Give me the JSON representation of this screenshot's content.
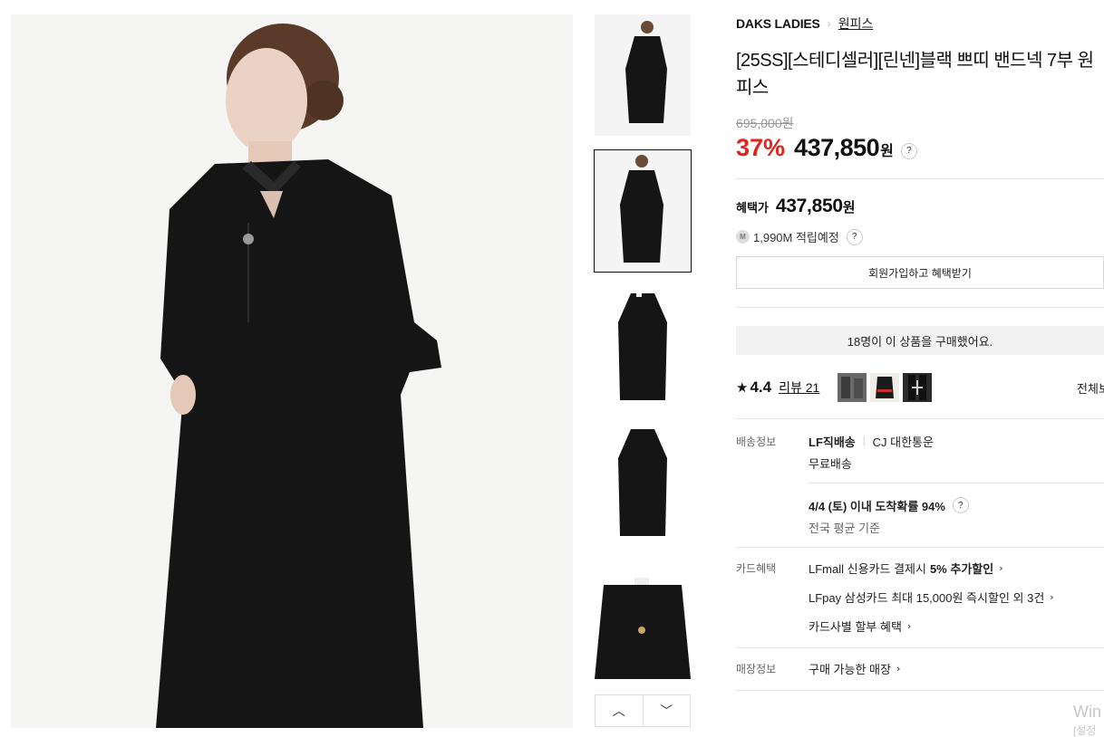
{
  "breadcrumb": {
    "brand": "DAKS LADIES",
    "category": "원피스"
  },
  "product": {
    "title": "[25SS][스테디셀러][린넨]블랙 쁘띠 밴드넥 7부 원피스",
    "original_price": "695,000원",
    "discount": "37%",
    "sale_price": "437,850",
    "currency": "원",
    "help": "?"
  },
  "benefit": {
    "label": "혜택가",
    "price": "437,850",
    "currency": "원",
    "points_icon": "M",
    "points": "1,990M 적립예정",
    "help": "?",
    "join_button": "회원가입하고 혜택받기"
  },
  "buyers_note": "18명이 이 상품을 구매했어요.",
  "review": {
    "star": "★",
    "rating": "4.4",
    "link": "리뷰 21",
    "view_all": "전체보기"
  },
  "shipping": {
    "label": "배송정보",
    "method": "LF직배송",
    "carrier": "CJ 대한통운",
    "fee": "무료배송",
    "arrival": "4/4 (토) 이내 도착확률 94%",
    "help": "?",
    "arrival_note": "전국 평균 기준"
  },
  "card": {
    "label": "카드혜택",
    "line1_text": "LFmall 신용카드 결제시 ",
    "line1_bold": "5% 추가할인",
    "line2": "LFpay 삼성카드 최대 15,000원 즉시할인 외 3건",
    "line3": "카드사별 할부 혜택"
  },
  "store": {
    "label": "매장정보",
    "link": "구매 가능한 매장"
  },
  "nav": {
    "up": "︿",
    "down": "﹀",
    "chevron": "›"
  },
  "watermark": {
    "line1": "Win",
    "line2": "[설정"
  },
  "colors": {
    "discount": "#e0231c",
    "text": "#111111",
    "muted": "#999999",
    "divider": "#e5e5e5"
  }
}
